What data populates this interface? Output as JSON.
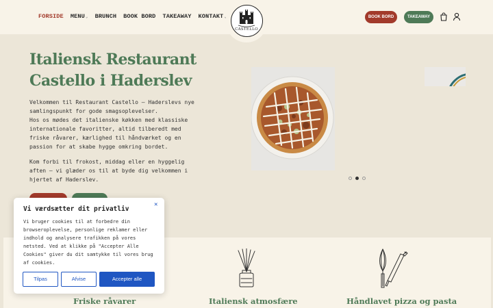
{
  "nav": {
    "items": [
      {
        "label": "FORSIDE",
        "active": true,
        "has_dropdown": false
      },
      {
        "label": "MENU",
        "active": false,
        "has_dropdown": true
      },
      {
        "label": "BRUNCH",
        "active": false,
        "has_dropdown": false
      },
      {
        "label": "BOOK BORD",
        "active": false,
        "has_dropdown": false
      },
      {
        "label": "TAKEAWAY",
        "active": false,
        "has_dropdown": false
      },
      {
        "label": "KONTAKT",
        "active": false,
        "has_dropdown": true
      }
    ]
  },
  "logo": {
    "text": "CASTELLO"
  },
  "header_buttons": {
    "book": "BOOK BORD",
    "takeaway": "TAKEAWAY"
  },
  "header_icons": [
    "shopping-bag-icon",
    "user-icon"
  ],
  "hero": {
    "title": "Italiensk Restaurant Castello i Haderslev",
    "paragraph1": "Velkommen til Restaurant Castello – Haderslevs nye samlingspunkt for gode smagsoplevelser.\nHos os mødes det italienske køkken med klassiske internationale favoritter, altid tilberedt med friske råvarer, kærlighed til håndværket og en passion for at skabe hygge omkring bordet.",
    "paragraph2": "Kom forbi til frokost, middag eller en hyggelig aften – vi glæder os til at byde dig velkommen i hjertet af Haderslev."
  },
  "carousel": {
    "slide_count": 3,
    "active_index": 1
  },
  "features": {
    "items": [
      {
        "title": "Friske råvarer"
      },
      {
        "title": "Italiensk atmosfære",
        "icon": "reed-diffuser-icon"
      },
      {
        "title": "Håndlavet pizza og pasta",
        "icon": "whisk-rolling-pin-icon"
      }
    ]
  },
  "cookie": {
    "title": "Vi værdsætter dit privatliv",
    "body": "Vi bruger cookies til at forbedre din browseroplevelse, personlige reklamer eller indhold og analysere trafikken på vores netsted. Ved at klikke på \"Accepter Alle Cookies\" giver du dit samtykke til vores brug af cookies.",
    "buttons": {
      "customize": "Tilpas",
      "reject": "Afvise",
      "accept": "Accepter alle"
    }
  },
  "colors": {
    "brand_green": "#4e7a57",
    "brand_red": "#a23a2b",
    "cookie_blue": "#1f56c2",
    "background": "#ece6d8"
  }
}
